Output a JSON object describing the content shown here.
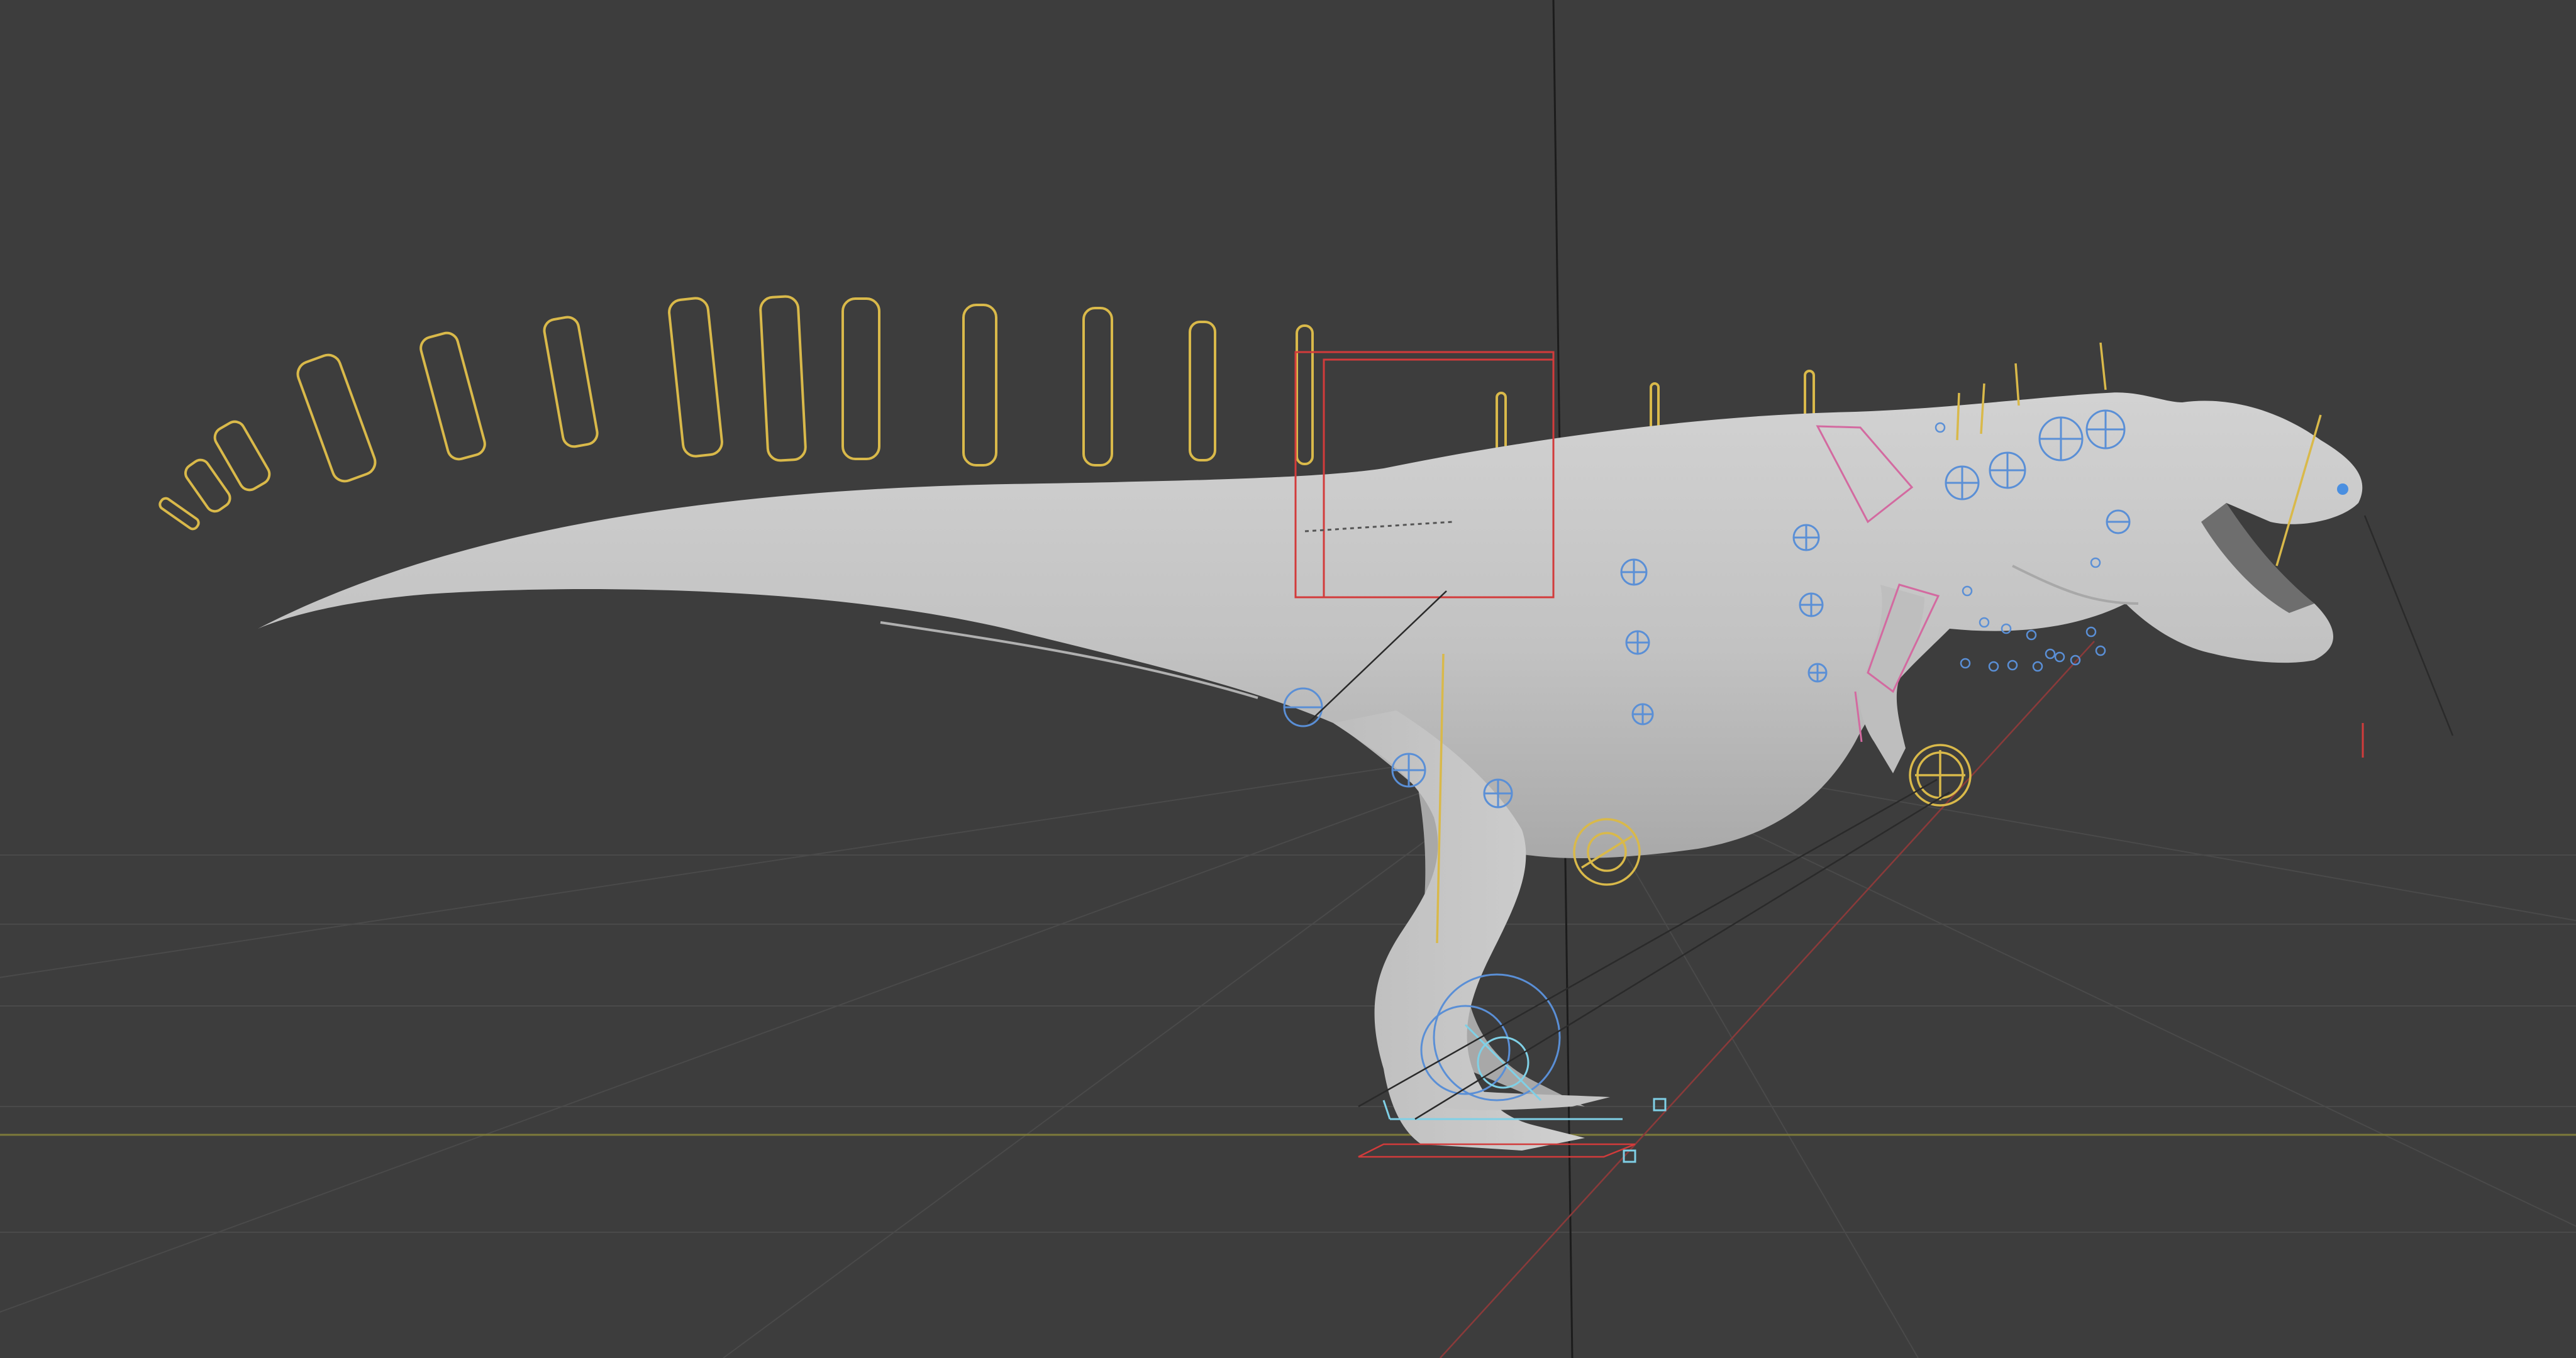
{
  "app": {
    "name": "3D viewport"
  },
  "viewport": {
    "background_color": "#3d3d3d",
    "grid_color": "#4a4a4a",
    "x_axis_color": "#8a3a3a",
    "y_axis_color": "#8a8a3a",
    "z_axis_color": "#1f1f1f",
    "mesh_color": "#c8c8c8"
  },
  "scene": {
    "object": "dinosaur-mesh",
    "armature_colors": {
      "fk_controls": "#e0c24a",
      "ik_controls": "#5a8fd6",
      "selected": "#d23b3b",
      "arm_chain": "#d36aa0",
      "helper": "#7fd0e6"
    }
  }
}
